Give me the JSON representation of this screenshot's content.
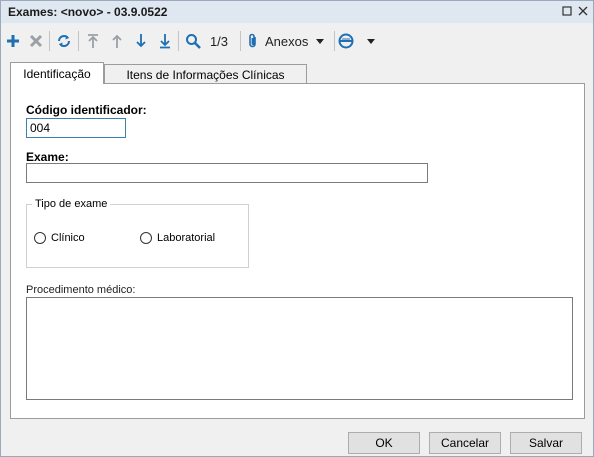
{
  "window": {
    "title": "Exames: <novo> - 03.9.0522"
  },
  "titlebar_buttons": [
    {
      "icon": "maximize-icon"
    },
    {
      "icon": "close-icon"
    }
  ],
  "toolbar": {
    "page_indicator": "1/3",
    "attachments_label": "Anexos"
  },
  "tabs": [
    {
      "label": "Identificação",
      "active": true
    },
    {
      "label": "Itens de Informações Clínicas",
      "active": false
    }
  ],
  "form": {
    "codigo": {
      "label": "Código identificador:",
      "value": "004"
    },
    "exame": {
      "label": "Exame:",
      "value": ""
    },
    "tipo": {
      "title": "Tipo de exame",
      "options": [
        "Clínico",
        "Laboratorial"
      ]
    },
    "procedimento": {
      "label": "Procedimento médico:",
      "value": ""
    }
  },
  "buttons": {
    "ok": "OK",
    "cancel": "Cancelar",
    "save": "Salvar"
  },
  "colors": {
    "accent_blue": "#1f6fb2",
    "titlebar_bg": "#dfe7f1",
    "selection": "#3a6ea5"
  }
}
